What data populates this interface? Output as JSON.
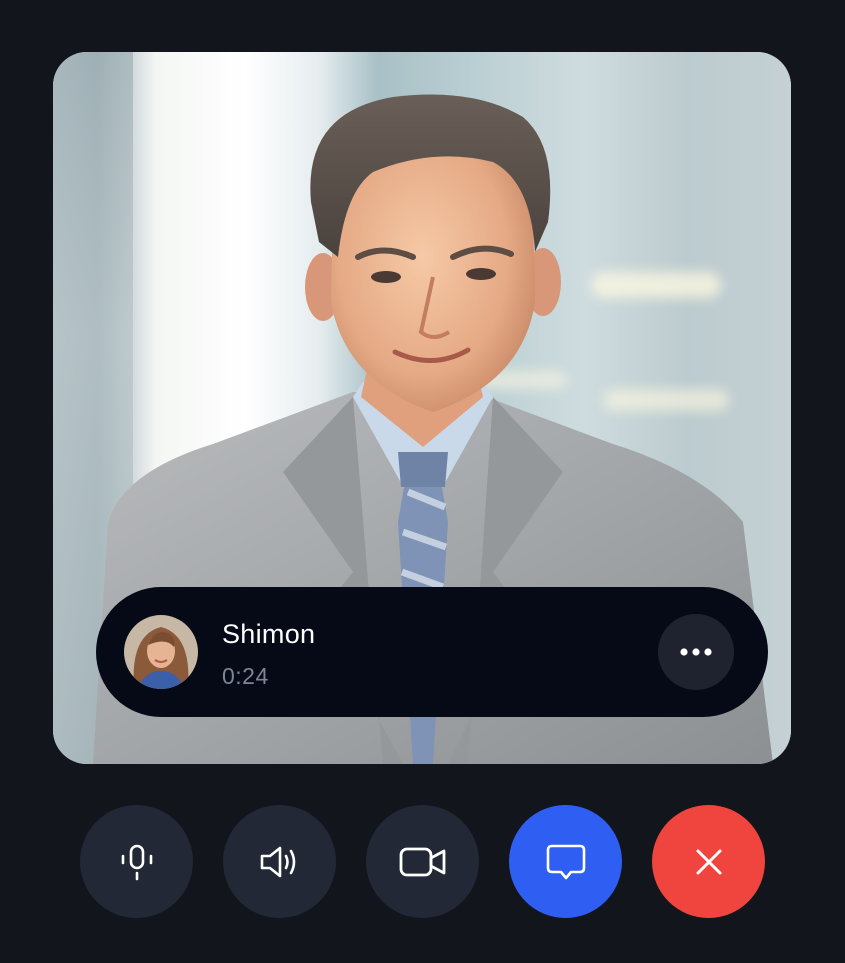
{
  "call": {
    "caller_name": "Shimon",
    "duration": "0:24"
  },
  "icons": {
    "more": "more-horizontal-icon",
    "mic": "microphone-icon",
    "speaker": "speaker-icon",
    "camera": "video-camera-icon",
    "chat": "chat-bubble-icon",
    "end": "close-icon"
  },
  "colors": {
    "background": "#12151c",
    "call_bar": "#060a17",
    "control_button": "#232836",
    "chat_button": "#2f5ef2",
    "end_call_button": "#f0453f",
    "timer_text": "#7e8595"
  }
}
